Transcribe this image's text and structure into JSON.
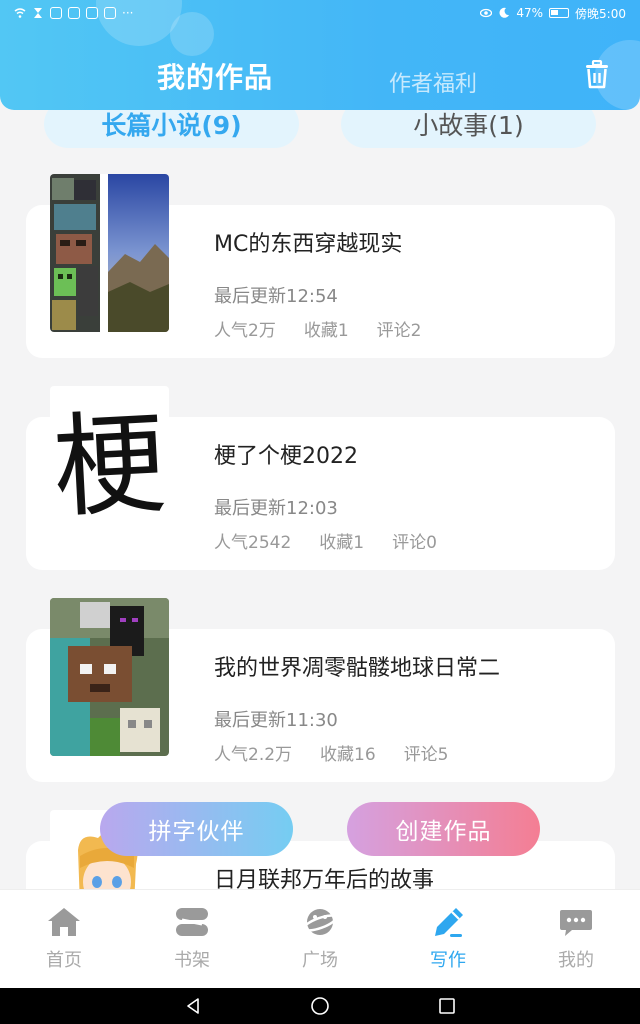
{
  "status_bar": {
    "battery": "47%",
    "time": "傍晚5:00",
    "more": "···"
  },
  "header": {
    "title": "我的作品",
    "tab_welfare": "作者福利",
    "icon": "trash-icon"
  },
  "type_tabs": [
    {
      "label": "长篇小说(9)",
      "active": true
    },
    {
      "label": "小故事(1)",
      "active": false
    }
  ],
  "works": [
    {
      "title": "MC的东西穿越现实",
      "update": "最后更新12:54",
      "popularity": "人气2万",
      "favorites": "收藏1",
      "comments": "评论2"
    },
    {
      "title": "梗了个梗2022",
      "update": "最后更新12:03",
      "popularity": "人气2542",
      "favorites": "收藏1",
      "comments": "评论0",
      "cover_text": "梗"
    },
    {
      "title": "我的世界凋零骷髅地球日常二",
      "update": "最后更新11:30",
      "popularity": "人气2.2万",
      "favorites": "收藏16",
      "comments": "评论5"
    },
    {
      "title": "日月联邦万年后的故事"
    }
  ],
  "float_buttons": {
    "partner": "拼字伙伴",
    "create": "创建作品"
  },
  "bottom_nav": [
    {
      "label": "首页",
      "icon": "home-icon"
    },
    {
      "label": "书架",
      "icon": "bookshelf-icon"
    },
    {
      "label": "广场",
      "icon": "planet-icon"
    },
    {
      "label": "写作",
      "icon": "pen-icon",
      "active": true
    },
    {
      "label": "我的",
      "icon": "chat-bubble-icon"
    }
  ],
  "colors": {
    "accent": "#2ea7ef",
    "header_start": "#52c7f4",
    "header_end": "#3fb3f9"
  }
}
